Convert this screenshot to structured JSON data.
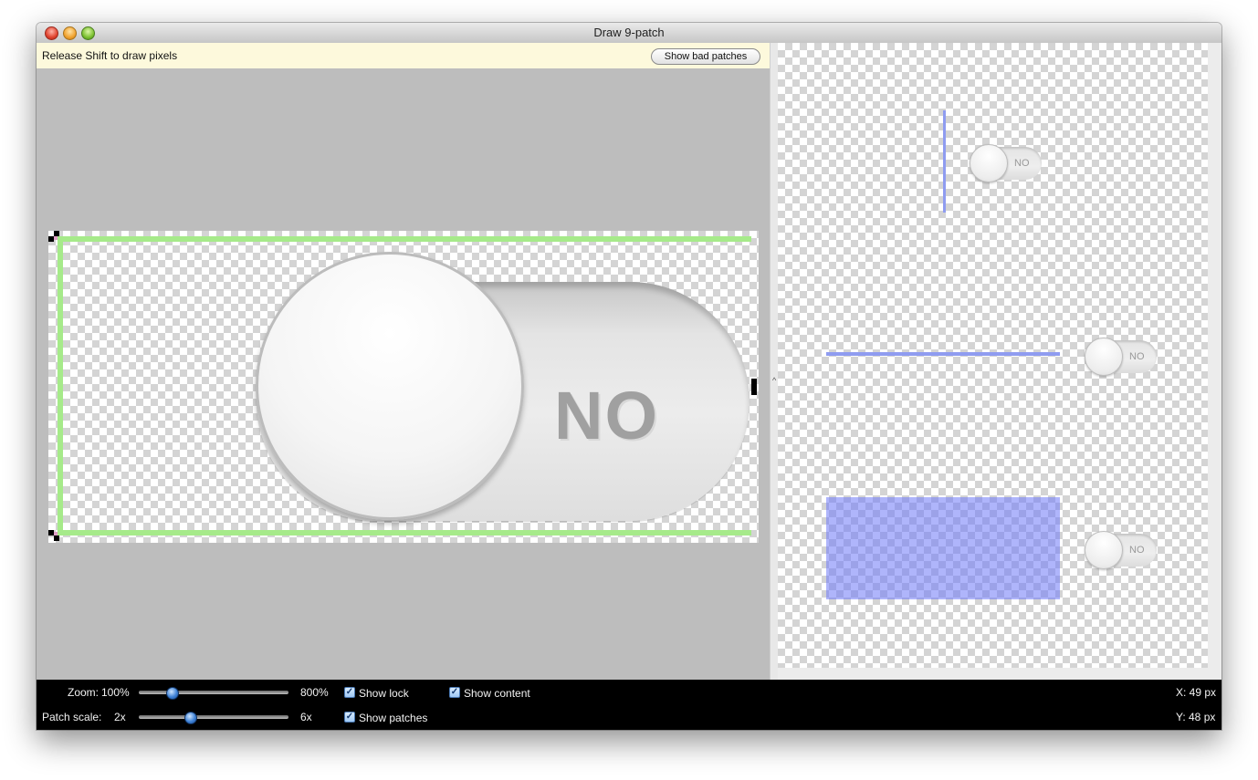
{
  "window": {
    "title": "Draw 9-patch"
  },
  "editor": {
    "info_text": "Release Shift to draw pixels",
    "show_bad_patches_label": "Show bad patches",
    "image_label": "NO"
  },
  "preview": {
    "switch_labels": [
      "NO",
      "NO",
      "NO"
    ]
  },
  "statusbar": {
    "zoom_label": "Zoom:",
    "zoom_min": "100%",
    "zoom_max": "800%",
    "zoom_level": 0.2,
    "patch_scale_label": "Patch scale:",
    "patch_min": "2x",
    "patch_max": "6x",
    "patch_level": 0.33,
    "show_lock": {
      "label": "Show lock",
      "checked": true
    },
    "show_content": {
      "label": "Show content",
      "checked": true
    },
    "show_patches": {
      "label": "Show patches",
      "checked": true
    },
    "x_readout": "X: 49 px",
    "y_readout": "Y: 48 px"
  },
  "colors": {
    "patch_guide": "#a6ea8a",
    "preview_patch": "#8f9cf0",
    "statusbar_bg": "#000000"
  }
}
